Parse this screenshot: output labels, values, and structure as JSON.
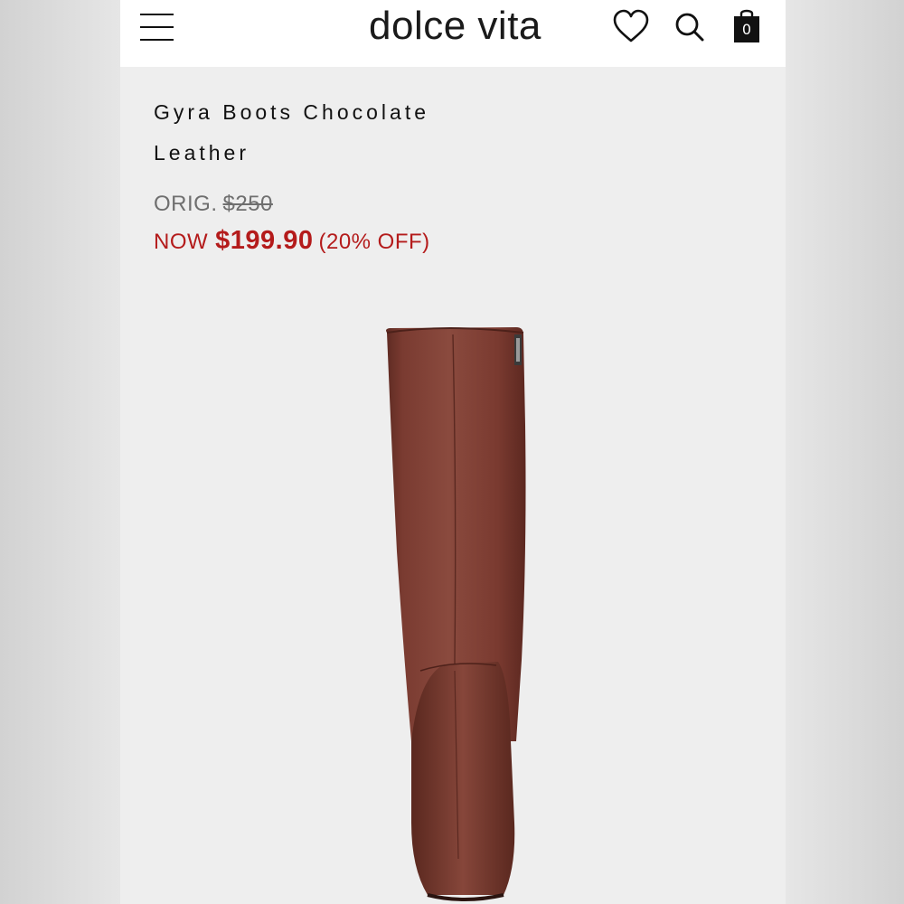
{
  "header": {
    "brand": "dolce vita",
    "cart_count": "0",
    "icons": [
      "menu-icon",
      "heart-icon",
      "search-icon",
      "shopping-bag-icon"
    ]
  },
  "product": {
    "title_line1": "Gyra Boots Chocolate",
    "title_line2": "Leather",
    "orig_label": "ORIG.",
    "orig_price": "$250",
    "now_label": "NOW",
    "sale_price": "$199.90",
    "discount": "(20% OFF)"
  },
  "colors": {
    "sale": "#b41b1b",
    "boot": "#7a3b31"
  }
}
